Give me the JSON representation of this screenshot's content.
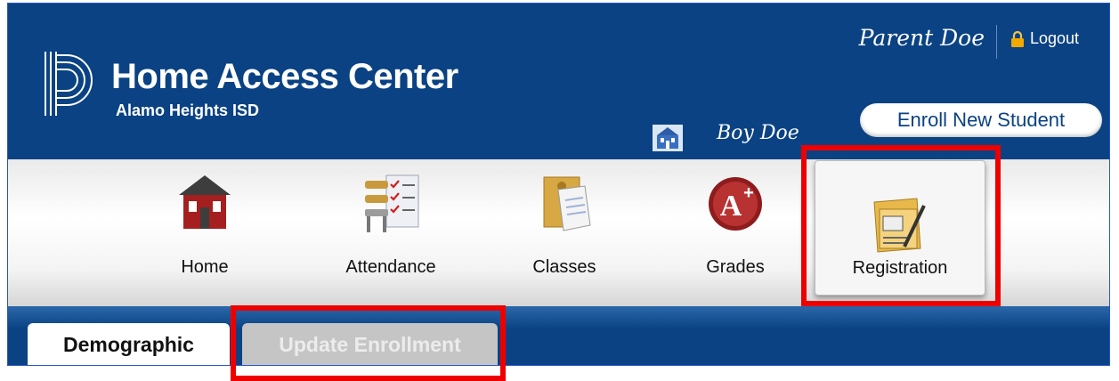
{
  "header": {
    "app_title": "Home Access Center",
    "district": "Alamo Heights ISD",
    "user_name": "Parent Doe",
    "logout_label": "Logout",
    "student_name": "Boy Doe",
    "enroll_button_label": "Enroll New Student"
  },
  "nav": {
    "items": [
      {
        "label": "Home",
        "icon": "home-icon"
      },
      {
        "label": "Attendance",
        "icon": "attendance-icon"
      },
      {
        "label": "Classes",
        "icon": "classes-icon"
      },
      {
        "label": "Grades",
        "icon": "grades-icon"
      },
      {
        "label": "Registration",
        "icon": "registration-icon",
        "selected": true
      }
    ]
  },
  "tabs": [
    {
      "label": "Demographic",
      "active": true
    },
    {
      "label": "Update Enrollment",
      "active": false
    }
  ],
  "colors": {
    "header_bg": "#0a4283",
    "highlight": "#ee0000",
    "frame_border": "#2a56c6"
  }
}
